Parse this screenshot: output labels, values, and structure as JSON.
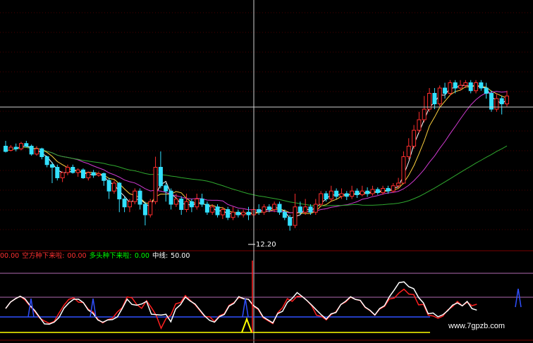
{
  "colors": {
    "background": "#000000",
    "candle_up": "#ff2d2d",
    "candle_down": "#33e0ff",
    "ma_white": "#ffffff",
    "ma_yellow": "#ffd23f",
    "ma_magenta": "#d03ad0",
    "ma_green": "#2fa82f",
    "grid": "#4a0000",
    "crosshair": "#cfcfcf",
    "osc_red": "#ff2020",
    "osc_white": "#ffffff",
    "blue_signal": "#3050ff",
    "yellow_signal": "#ffff00",
    "hline_purple": "#b06ab0"
  },
  "price_panel": {
    "low_marker_label": "12.20"
  },
  "indicator_legend": [
    {
      "text": "00.00",
      "color": "#ff3030"
    },
    {
      "text": "空方种下来啦:",
      "color": "#ff3030"
    },
    {
      "text": "00.00",
      "color": "#ff3030"
    },
    {
      "text": "多头种下来啦:",
      "color": "#00ff00"
    },
    {
      "text": "0.00",
      "color": "#00ff00"
    },
    {
      "text": "中线:",
      "color": "#ffffff"
    },
    {
      "text": "50.00",
      "color": "#ffffff"
    }
  ],
  "watermark": "www.7gpzb.com",
  "chart_data": {
    "type": "candlestick",
    "candles": [
      [
        0.3,
        0.2,
        0.4,
        0.18
      ],
      [
        0.22,
        0.28,
        0.32,
        0.2
      ],
      [
        0.28,
        0.25,
        0.35,
        0.2
      ],
      [
        0.25,
        0.35,
        0.38,
        0.22
      ],
      [
        0.35,
        0.3,
        0.4,
        0.28
      ],
      [
        0.3,
        0.15,
        0.33,
        0.12
      ],
      [
        0.15,
        0.25,
        0.3,
        0.12
      ],
      [
        0.25,
        0.1,
        0.27,
        0.05
      ],
      [
        0.1,
        -0.05,
        0.12,
        -0.1
      ],
      [
        -0.05,
        -0.1,
        0.0,
        -0.4
      ],
      [
        -0.1,
        -0.3,
        -0.05,
        -0.35
      ],
      [
        -0.3,
        -0.2,
        -0.18,
        -0.38
      ],
      [
        -0.2,
        -0.1,
        -0.05,
        -0.25
      ],
      [
        -0.1,
        -0.2,
        -0.05,
        -0.22
      ],
      [
        -0.2,
        -0.15,
        -0.12,
        -0.28
      ],
      [
        -0.15,
        -0.3,
        -0.12,
        -0.32
      ],
      [
        -0.3,
        -0.2,
        -0.18,
        -0.35
      ],
      [
        -0.2,
        -0.25,
        -0.15,
        -0.3
      ],
      [
        -0.25,
        -0.22,
        -0.18,
        -0.28
      ],
      [
        -0.22,
        -0.35,
        -0.2,
        -0.45
      ],
      [
        -0.35,
        -0.55,
        -0.3,
        -0.7
      ],
      [
        -0.55,
        -0.4,
        -0.35,
        -0.6
      ],
      [
        -0.4,
        -0.7,
        -0.38,
        -0.95
      ],
      [
        -0.7,
        -0.85,
        -0.65,
        -0.95
      ],
      [
        -0.85,
        -0.75,
        -0.7,
        -0.95
      ],
      [
        -0.75,
        -0.55,
        -0.5,
        -0.8
      ],
      [
        -0.55,
        -0.8,
        -0.5,
        -0.9
      ],
      [
        -0.8,
        -1.0,
        -0.75,
        -1.2
      ],
      [
        -1.0,
        -0.75,
        -0.7,
        -1.05
      ],
      [
        -0.75,
        -0.1,
        0.1,
        -0.8
      ],
      [
        -0.1,
        -0.45,
        0.2,
        -0.5
      ],
      [
        -0.45,
        -0.55,
        -0.4,
        -0.75
      ],
      [
        -0.55,
        -0.8,
        -0.5,
        -0.9
      ],
      [
        -0.8,
        -0.7,
        -0.6,
        -0.85
      ],
      [
        -0.7,
        -0.9,
        -0.65,
        -1.0
      ],
      [
        -0.9,
        -0.75,
        -0.6,
        -0.95
      ],
      [
        -0.75,
        -0.85,
        -0.7,
        -0.95
      ],
      [
        -0.85,
        -0.7,
        -0.6,
        -0.9
      ],
      [
        -0.7,
        -0.8,
        -0.6,
        -0.85
      ],
      [
        -0.8,
        -0.95,
        -0.75,
        -1.0
      ],
      [
        -0.95,
        -0.85,
        -0.8,
        -1.0
      ],
      [
        -0.85,
        -1.0,
        -0.8,
        -1.05
      ],
      [
        -1.0,
        -0.9,
        -0.85,
        -1.08
      ],
      [
        -0.9,
        -1.05,
        -0.85,
        -1.1
      ],
      [
        -1.05,
        -0.95,
        -0.85,
        -1.1
      ],
      [
        -0.95,
        -1.0,
        -0.9,
        -1.05
      ],
      [
        -1.0,
        -0.95,
        -0.9,
        -1.05
      ],
      [
        -0.95,
        -1.0,
        -0.85,
        -1.1
      ],
      [
        -1.0,
        -0.9,
        -0.85,
        -1.05
      ],
      [
        -0.9,
        -0.95,
        -0.8,
        -1.0
      ],
      [
        -0.95,
        -0.85,
        -0.8,
        -1.0
      ],
      [
        -0.85,
        -0.9,
        -0.8,
        -0.95
      ],
      [
        -0.9,
        -0.8,
        -0.75,
        -0.95
      ],
      [
        -0.8,
        -0.95,
        -0.75,
        -1.0
      ],
      [
        -0.95,
        -1.05,
        -0.9,
        -1.1
      ],
      [
        -1.05,
        -1.2,
        -1.0,
        -1.3
      ],
      [
        -1.2,
        -0.85,
        -0.6,
        -1.25
      ],
      [
        -0.85,
        -0.95,
        -0.75,
        -1.0
      ],
      [
        -0.95,
        -0.85,
        -0.7,
        -1.0
      ],
      [
        -0.85,
        -0.95,
        -0.8,
        -1.0
      ],
      [
        -0.95,
        -0.8,
        -0.7,
        -1.0
      ],
      [
        -0.8,
        -0.6,
        -0.55,
        -0.85
      ],
      [
        -0.6,
        -0.7,
        -0.55,
        -0.75
      ],
      [
        -0.7,
        -0.55,
        -0.45,
        -0.75
      ],
      [
        -0.55,
        -0.65,
        -0.5,
        -0.7
      ],
      [
        -0.65,
        -0.6,
        -0.5,
        -0.7
      ],
      [
        -0.6,
        -0.65,
        -0.55,
        -0.72
      ],
      [
        -0.65,
        -0.55,
        -0.45,
        -0.7
      ],
      [
        -0.55,
        -0.62,
        -0.5,
        -0.68
      ],
      [
        -0.62,
        -0.55,
        -0.45,
        -0.65
      ],
      [
        -0.55,
        -0.6,
        -0.48,
        -0.66
      ],
      [
        -0.6,
        -0.52,
        -0.45,
        -0.64
      ],
      [
        -0.52,
        -0.58,
        -0.48,
        -0.62
      ],
      [
        -0.58,
        -0.5,
        -0.45,
        -0.62
      ],
      [
        -0.5,
        -0.55,
        -0.45,
        -0.6
      ],
      [
        -0.55,
        -0.45,
        -0.4,
        -0.58
      ],
      [
        -0.45,
        -0.4,
        -0.3,
        -0.5
      ],
      [
        -0.4,
        0.1,
        0.2,
        -0.42
      ],
      [
        0.1,
        0.3,
        0.45,
        0.05
      ],
      [
        0.3,
        0.6,
        0.7,
        0.25
      ],
      [
        0.6,
        0.8,
        0.95,
        0.55
      ],
      [
        0.8,
        1.0,
        1.25,
        0.75
      ],
      [
        1.0,
        1.3,
        1.4,
        0.95
      ],
      [
        1.3,
        1.1,
        1.4,
        1.0
      ],
      [
        1.1,
        1.4,
        1.45,
        1.05
      ],
      [
        1.4,
        1.3,
        1.5,
        1.2
      ],
      [
        1.3,
        1.5,
        1.55,
        1.25
      ],
      [
        1.5,
        1.4,
        1.55,
        1.3
      ],
      [
        1.4,
        1.45,
        1.55,
        1.35
      ],
      [
        1.45,
        1.5,
        1.55,
        1.4
      ],
      [
        1.5,
        1.35,
        1.55,
        1.3
      ],
      [
        1.35,
        1.5,
        1.55,
        1.3
      ],
      [
        1.5,
        1.4,
        1.55,
        1.35
      ],
      [
        1.4,
        1.3,
        1.5,
        1.2
      ],
      [
        1.3,
        1.0,
        1.35,
        0.95
      ],
      [
        1.0,
        1.2,
        1.3,
        0.95
      ],
      [
        1.2,
        1.1,
        1.25,
        0.9
      ],
      [
        1.1,
        1.25,
        1.35,
        1.05
      ]
    ]
  }
}
